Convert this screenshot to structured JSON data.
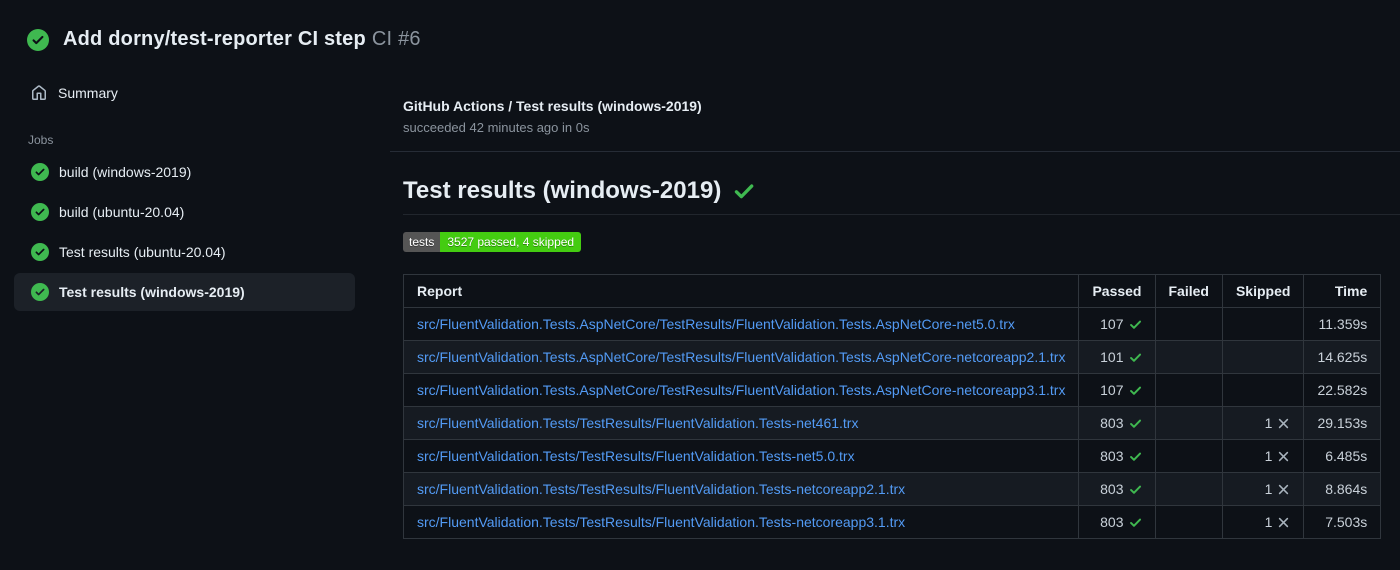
{
  "colors": {
    "background": "#0d1117",
    "success_green": "#3fb950",
    "badge_gray": "#555555",
    "badge_green": "#44cc11",
    "link_blue": "#539bf5",
    "muted_text": "#8b949e"
  },
  "header": {
    "title": "Add dorny/test-reporter CI step",
    "run_number": "CI #6",
    "status_icon": "check-circle-icon"
  },
  "sidebar": {
    "summary_label": "Summary",
    "summary_icon": "home-icon",
    "jobs_label": "Jobs",
    "jobs": [
      {
        "label": "build (windows-2019)",
        "status": "success",
        "selected": false
      },
      {
        "label": "build (ubuntu-20.04)",
        "status": "success",
        "selected": false
      },
      {
        "label": "Test results (ubuntu-20.04)",
        "status": "success",
        "selected": false
      },
      {
        "label": "Test results (windows-2019)",
        "status": "success",
        "selected": true
      }
    ]
  },
  "main": {
    "check_title": "GitHub Actions / Test results (windows-2019)",
    "check_status": "succeeded 42 minutes ago in 0s",
    "section_title": "Test results (windows-2019)",
    "section_status_icon": "check-icon",
    "badge": {
      "label": "tests",
      "value": "3527 passed, 4 skipped"
    },
    "table": {
      "headers": [
        "Report",
        "Passed",
        "Failed",
        "Skipped",
        "Time"
      ],
      "rows": [
        {
          "report": "src/FluentValidation.Tests.AspNetCore/TestResults/FluentValidation.Tests.AspNetCore-net5.0.trx",
          "passed": "107",
          "failed": "",
          "skipped": "",
          "time": "11.359s"
        },
        {
          "report": "src/FluentValidation.Tests.AspNetCore/TestResults/FluentValidation.Tests.AspNetCore-netcoreapp2.1.trx",
          "passed": "101",
          "failed": "",
          "skipped": "",
          "time": "14.625s"
        },
        {
          "report": "src/FluentValidation.Tests.AspNetCore/TestResults/FluentValidation.Tests.AspNetCore-netcoreapp3.1.trx",
          "passed": "107",
          "failed": "",
          "skipped": "",
          "time": "22.582s"
        },
        {
          "report": "src/FluentValidation.Tests/TestResults/FluentValidation.Tests-net461.trx",
          "passed": "803",
          "failed": "",
          "skipped": "1",
          "time": "29.153s"
        },
        {
          "report": "src/FluentValidation.Tests/TestResults/FluentValidation.Tests-net5.0.trx",
          "passed": "803",
          "failed": "",
          "skipped": "1",
          "time": "6.485s"
        },
        {
          "report": "src/FluentValidation.Tests/TestResults/FluentValidation.Tests-netcoreapp2.1.trx",
          "passed": "803",
          "failed": "",
          "skipped": "1",
          "time": "8.864s"
        },
        {
          "report": "src/FluentValidation.Tests/TestResults/FluentValidation.Tests-netcoreapp3.1.trx",
          "passed": "803",
          "failed": "",
          "skipped": "1",
          "time": "7.503s"
        }
      ]
    }
  }
}
